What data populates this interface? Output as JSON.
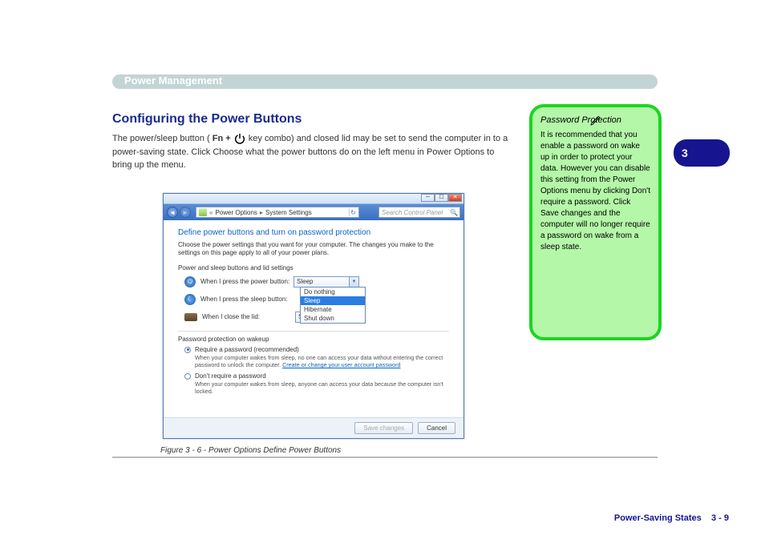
{
  "header": {
    "title": "Power Management"
  },
  "section": {
    "heading": "Configuring the Power Buttons",
    "body_before": "The power/sleep button (",
    "body_after": " key combo) and closed lid may be set to send the computer in to a power-saving state. Click Choose what the power buttons do on the left menu in Power Options to bring up the menu."
  },
  "keycombo": "Fn + ",
  "note": {
    "title": "Password Protection",
    "text": "It is recommended that you enable a password on wake up in order to protect your data. However you can disable this setting from the Power Options menu by clicking Don't require a password. Click Save changes and the computer will no longer require a password on wake from a sleep state."
  },
  "tab": {
    "label": "3"
  },
  "dialog": {
    "nav": {
      "crumb1": "Power Options",
      "crumb2": "System Settings",
      "search_ph": "Search Control Panel"
    },
    "h": "Define power buttons and turn on password protection",
    "p1": "Choose the power settings that you want for your computer. The changes you make to the settings on this page apply to all of your power plans.",
    "sub1": "Power and sleep buttons and lid settings",
    "row1": {
      "label": "When I press the power button:",
      "value": "Sleep"
    },
    "row2": {
      "label": "When I press the sleep button:",
      "value": ""
    },
    "row3": {
      "label": "When I close the lid:",
      "value": "Sleep"
    },
    "dropdown": [
      "Do nothing",
      "Sleep",
      "Hibernate",
      "Shut down"
    ],
    "sub2": "Password protection on wakeup",
    "rq": {
      "label": "Require a password (recommended)",
      "desc1": "When your computer wakes from sleep, no one can access your data without entering the correct password to unlock the computer. ",
      "link": "Create or change your user account password"
    },
    "dr": {
      "label": "Don't require a password",
      "desc": "When your computer wakes from sleep, anyone can access your data because the computer isn't locked."
    },
    "btn_save": "Save changes",
    "btn_cancel": "Cancel"
  },
  "caption": "Figure 3 - 6 - Power Options Define Power Buttons",
  "page_num": "3 - 9",
  "page_ref": "Power-Saving States"
}
